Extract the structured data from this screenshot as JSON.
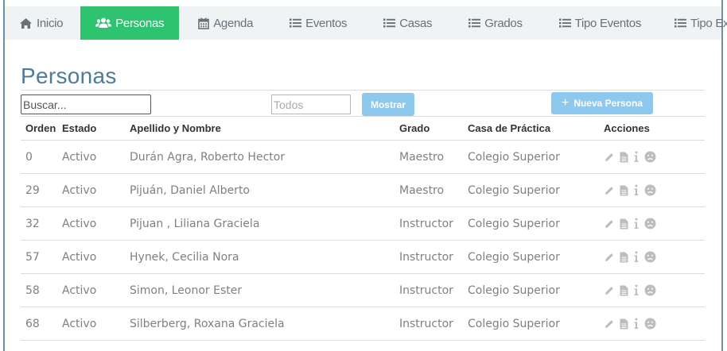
{
  "nav": {
    "items": [
      {
        "label": "Inicio",
        "icon": "home-icon"
      },
      {
        "label": "Personas",
        "icon": "users-icon",
        "active": true
      },
      {
        "label": "Agenda",
        "icon": "calendar-icon"
      },
      {
        "label": "Eventos",
        "icon": "list-icon"
      },
      {
        "label": "Casas",
        "icon": "list-icon"
      },
      {
        "label": "Grados",
        "icon": "list-icon"
      },
      {
        "label": "Tipo Eventos",
        "icon": "list-icon"
      },
      {
        "label": "Tipo Extras",
        "icon": "list-icon"
      }
    ]
  },
  "colors": {
    "active_tab": "#2ec36f",
    "title": "#4e7b96",
    "button": "#8dc8ee"
  },
  "page": {
    "title": "Personas"
  },
  "toolbar": {
    "search_placeholder": "Buscar...",
    "filter_placeholder": "Todos",
    "mostrar_label": "Mostrar",
    "nueva_label": "Nueva Persona"
  },
  "table": {
    "headers": [
      "Orden",
      "Estado",
      "Apellido y Nombre",
      "Grado",
      "Casa de Práctica",
      "Acciones"
    ],
    "rows": [
      {
        "orden": "0",
        "estado": "Activo",
        "nombre": "Durán Agra, Roberto Hector",
        "grado": "Maestro",
        "casa": "Colegio Superior"
      },
      {
        "orden": "29",
        "estado": "Activo",
        "nombre": "Pijuán, Daniel Alberto",
        "grado": "Maestro",
        "casa": "Colegio Superior"
      },
      {
        "orden": "32",
        "estado": "Activo",
        "nombre": "Pijuan , Liliana Graciela",
        "grado": "Instructor",
        "casa": "Colegio Superior"
      },
      {
        "orden": "57",
        "estado": "Activo",
        "nombre": "Hynek, Cecilia Nora",
        "grado": "Instructor",
        "casa": "Colegio Superior"
      },
      {
        "orden": "58",
        "estado": "Activo",
        "nombre": "Simon, Leonor Ester",
        "grado": "Instructor",
        "casa": "Colegio Superior"
      },
      {
        "orden": "68",
        "estado": "Activo",
        "nombre": "Silberberg, Roxana Graciela",
        "grado": "Instructor",
        "casa": "Colegio Superior"
      }
    ],
    "action_icons": [
      "pencil-icon",
      "document-icon",
      "info-icon",
      "frown-icon"
    ]
  }
}
